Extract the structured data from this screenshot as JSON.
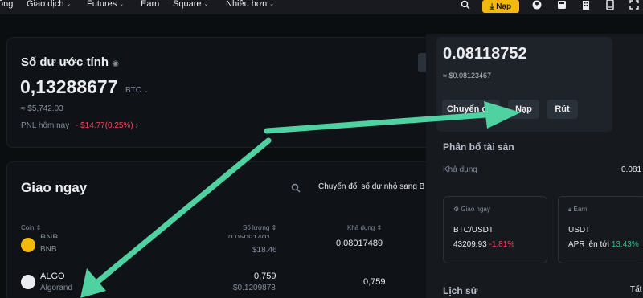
{
  "nav": {
    "items": [
      "ông",
      "Giao dịch",
      "Futures",
      "Earn",
      "Square",
      "Nhiều hơn"
    ],
    "deposit_label": "Nạp"
  },
  "balance": {
    "title": "Số dư ước tính",
    "amount": "0,13288677",
    "unit": "BTC",
    "fiat": "≈ $5,742.03",
    "pnl_label": "PNL hôm nay",
    "pnl_value": "- $14.77(0.25%)"
  },
  "spot": {
    "title": "Giao ngay",
    "convert_link": "Chuyển đổi số dư nhỏ sang B",
    "columns": [
      "Coin",
      "Số lượng",
      "Khả dụng"
    ],
    "rows": [
      {
        "symbol": "BNB",
        "name": "BNB",
        "qty": "0,05091401",
        "qty_fiat": "$18.46",
        "available": "0,08017489"
      },
      {
        "symbol": "ALGO",
        "name": "Algorand",
        "qty": "0,759",
        "qty_fiat": "$0.1209878",
        "available": "0,759"
      }
    ]
  },
  "popup": {
    "amount": "0.08118752",
    "fiat": "≈ $0.08123467",
    "buttons": [
      "Chuyển đổi",
      "Nạp",
      "Rút"
    ]
  },
  "allocation": {
    "title": "Phân bổ tài sản",
    "available_label": "Khả dụng",
    "available_value": "0.081"
  },
  "mini_cards": [
    {
      "label": "Giao ngay",
      "pair": "BTC/USDT",
      "price": "43209.93",
      "change": "-1.81%"
    },
    {
      "label": "Earn",
      "pair": "USDT",
      "apr_label": "APR lên tới",
      "apr_value": "13.43%"
    }
  ],
  "history": {
    "title": "Lịch sử",
    "right": "Tất"
  },
  "colors": {
    "accent": "#f0b90b",
    "arrow": "#4fd1a1",
    "down": "#f6465d",
    "up": "#2ebd85"
  }
}
